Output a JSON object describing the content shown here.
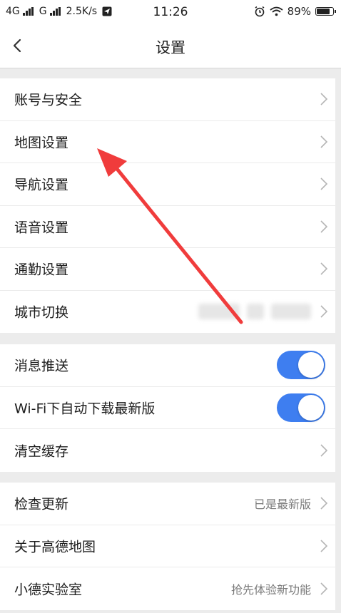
{
  "status": {
    "network1": "4G",
    "network2": "G",
    "speed": "2.5K/s",
    "time": "11:26",
    "battery": "89%",
    "battery_level": 0.89
  },
  "nav": {
    "title": "设置"
  },
  "group1": [
    {
      "label": "账号与安全"
    },
    {
      "label": "地图设置"
    },
    {
      "label": "导航设置"
    },
    {
      "label": "语音设置"
    },
    {
      "label": "通勤设置"
    },
    {
      "label": "城市切换"
    }
  ],
  "group2": {
    "push": {
      "label": "消息推送",
      "on": true
    },
    "wifi_download": {
      "label": "Wi-Fi下自动下载最新版",
      "on": true
    },
    "clear_cache": {
      "label": "清空缓存"
    }
  },
  "group3": [
    {
      "label": "检查更新",
      "value": "已是最新版"
    },
    {
      "label": "关于高德地图",
      "value": ""
    },
    {
      "label": "小德实验室",
      "value": "抢先体验新功能"
    }
  ],
  "colors": {
    "toggle_on": "#3e7ef0",
    "annotation_arrow": "#f03c3c"
  }
}
